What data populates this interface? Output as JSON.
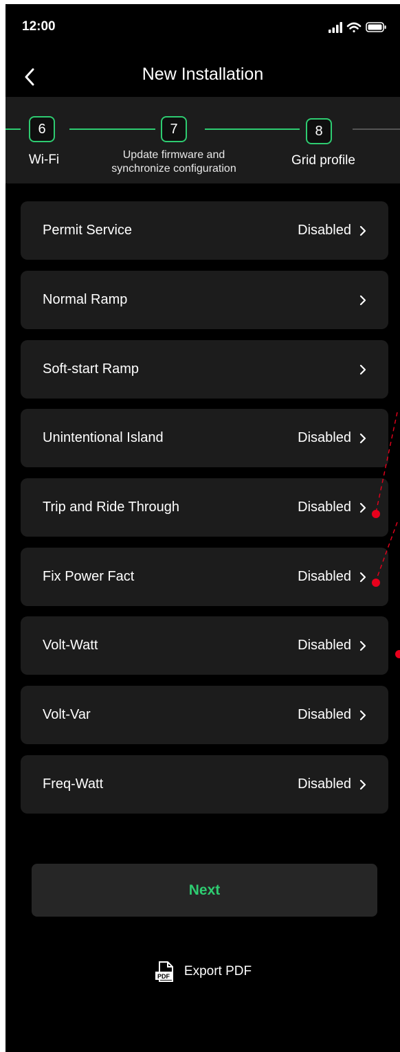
{
  "status_bar": {
    "time": "12:00"
  },
  "header": {
    "title": "New Installation"
  },
  "stepper": {
    "steps": [
      {
        "number": "6",
        "label": "Wi-Fi"
      },
      {
        "number": "7",
        "label_line1": "Update firmware and",
        "label_line2": "synchronize configuration"
      },
      {
        "number": "8",
        "label": "Grid profile"
      }
    ]
  },
  "settings": {
    "rows": [
      {
        "label": "Permit Service",
        "value": "Disabled"
      },
      {
        "label": "Normal Ramp",
        "value": ""
      },
      {
        "label": "Soft-start Ramp",
        "value": ""
      },
      {
        "label": "Unintentional Island",
        "value": "Disabled"
      },
      {
        "label": "Trip and Ride Through",
        "value": "Disabled"
      },
      {
        "label": "Fix Power Fact",
        "value": "Disabled"
      },
      {
        "label": "Volt-Watt",
        "value": "Disabled"
      },
      {
        "label": "Volt-Var",
        "value": "Disabled"
      },
      {
        "label": "Freq-Watt",
        "value": "Disabled"
      }
    ]
  },
  "actions": {
    "next_label": "Next",
    "export_label": "Export PDF",
    "export_icon_text": "PDF"
  },
  "colors": {
    "accent": "#2ecc71",
    "background": "#000000",
    "card": "#1c1c1c",
    "annotation": "#e8001c"
  }
}
